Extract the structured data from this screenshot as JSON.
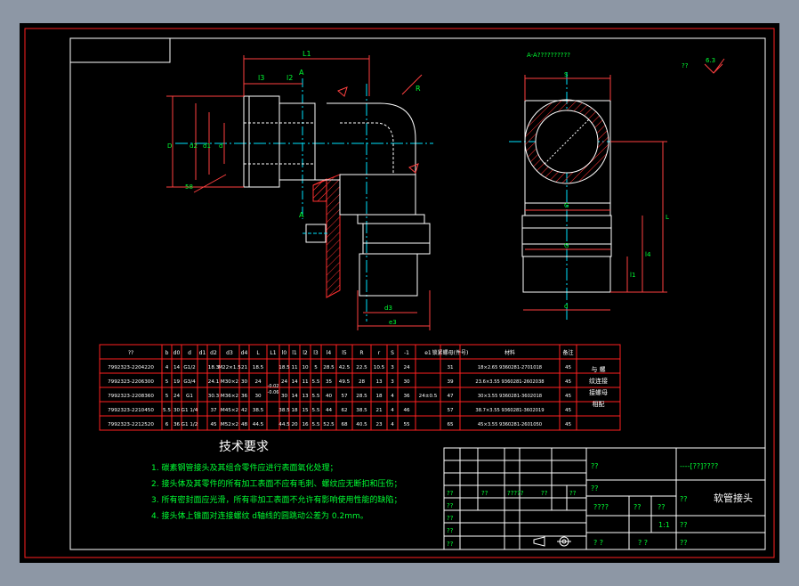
{
  "title_block": {
    "part_name": "软管接头",
    "code_text": "----[??]????",
    "cell_qq": "??",
    "label_a": "??",
    "label_b": "??",
    "label_c": "????",
    "label_d": "??",
    "label_e": "??",
    "scale": "1:1",
    "weight_label": "??",
    "sheet_label": "? ?",
    "sheet_label2": "? ?",
    "qq_small": "??",
    "row_sign": [
      "??",
      "??",
      "?????",
      "??",
      "??"
    ],
    "row_left": [
      "??",
      "??",
      "??",
      "??"
    ]
  },
  "drawing": {
    "section_label": "A-A??????????",
    "roughness_note": "??",
    "roughness_value": "6.3",
    "dim_labels": {
      "L1": "L1",
      "l3": "l3",
      "l2": "l2",
      "A_top": "A",
      "A_bottom": "A",
      "R": "R",
      "D": "D",
      "d2": "d2",
      "d1": "d1",
      "d_left": "d",
      "d3": "d3",
      "e3": "e3",
      "angle": "58",
      "S": "S",
      "G_a": "G",
      "G_b": "G",
      "d_right": "d",
      "L": "L",
      "l4": "l4",
      "l1": "l1"
    }
  },
  "table": {
    "headers": [
      "??",
      "b",
      "d0",
      "d",
      "d1",
      "d2",
      "d3",
      "d4",
      "L",
      "L1",
      "l0",
      "l1",
      "l2",
      "l3",
      "l4",
      "l5",
      "R",
      "r",
      "S",
      "-1",
      "e1",
      "锁紧螺母(件号)",
      "材料",
      "备注"
    ],
    "rows": [
      [
        "7992323-2204220",
        "4",
        "14",
        "G1/2",
        "",
        "18.3",
        "M22×1.5",
        "21",
        "18.5",
        "",
        "18.5",
        "11",
        "10",
        "5",
        "28.5",
        "42.5",
        "22.5",
        "10.5",
        "3",
        "24",
        "",
        "31",
        "18×2.65",
        "45"
      ],
      [
        "7992323-2206300",
        "5",
        "19",
        "G3/4",
        "",
        "24.1",
        "M30×2",
        "30",
        "24",
        "",
        "24",
        "14",
        "11",
        "5.5",
        "35",
        "49.5",
        "28",
        "13",
        "3",
        "30",
        "",
        "39",
        "23.6×3.55",
        "45"
      ],
      [
        "7992323-2208360",
        "5",
        "24",
        "G1",
        "",
        "30.3",
        "M36×2",
        "36",
        "30",
        "",
        "30",
        "14",
        "13",
        "5.5",
        "40",
        "57",
        "28.5",
        "18",
        "4",
        "36",
        "24±0.5",
        "47",
        "30×3.55",
        "45"
      ],
      [
        "7992323-2210450",
        "5.5",
        "30",
        "G1 1/4",
        "",
        "37",
        "M45×2",
        "42",
        "38.5",
        "",
        "38.5",
        "18",
        "15",
        "5.5",
        "44",
        "62",
        "38.5",
        "21",
        "4",
        "46",
        "",
        "57",
        "38.7×3.55",
        "45"
      ],
      [
        "7992323-2212520",
        "6",
        "36",
        "G1 1/2",
        "",
        "45",
        "M52×2",
        "48",
        "44.5",
        "",
        "44.5",
        "20",
        "16",
        "5.5",
        "52.5",
        "68",
        "40.5",
        "23",
        "4",
        "55",
        "",
        "65",
        "45×3.55",
        "45"
      ]
    ],
    "lock_nuts": [
      "9360281-2701018",
      "9360281-2602038",
      "9360281-3602018",
      "9360281-3602019",
      "9360281-2601050"
    ],
    "merged_note": [
      "与 螺",
      "纹连接",
      "接螺母",
      "相配"
    ],
    "tol": [
      "-0.02",
      "-0.06"
    ]
  },
  "tech": {
    "heading": "技术要求",
    "items": [
      "1. 碳素钢管接头及其组合零件应进行表面氧化处理；",
      "2. 接头体及其零件的所有加工表面不应有毛刺、螺纹应无断扣和压伤；",
      "3. 所有密封面应光滑，所有非加工表面不允许有影响使用性能的缺陷；",
      "4. 接头体上锥面对连接螺纹 d轴线的圆跳动公差为 0.2mm。"
    ]
  },
  "colors": {
    "frame": "#ff2020",
    "dims": "#ff4040",
    "center": "#00e5ff",
    "text": "#00ff33",
    "part": "#ffffff",
    "table_text": "#ffffff",
    "tech_heading": "#ffffff"
  }
}
